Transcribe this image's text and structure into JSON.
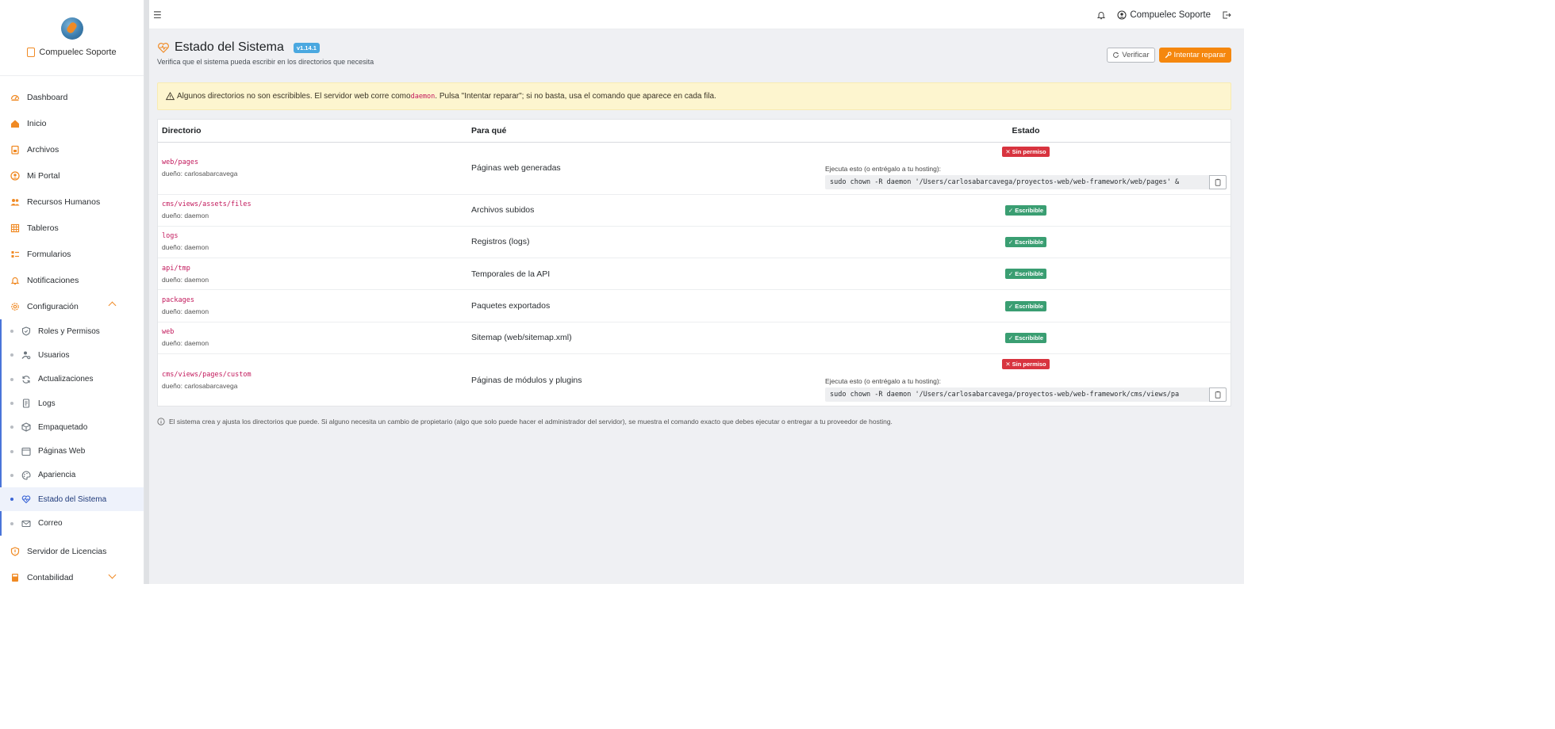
{
  "brand": {
    "name": "Compuelec Soporte"
  },
  "sidebar": {
    "items": [
      {
        "label": "Dashboard",
        "icon": "dashboard-icon"
      },
      {
        "label": "Inicio",
        "icon": "home-icon"
      },
      {
        "label": "Archivos",
        "icon": "archive-icon"
      },
      {
        "label": "Mi Portal",
        "icon": "user-circle-icon"
      },
      {
        "label": "Recursos Humanos",
        "icon": "users-icon"
      },
      {
        "label": "Tableros",
        "icon": "grid-icon"
      },
      {
        "label": "Formularios",
        "icon": "form-icon"
      },
      {
        "label": "Notificaciones",
        "icon": "bell-icon"
      },
      {
        "label": "Configuración",
        "icon": "gear-icon"
      }
    ],
    "sub_items": [
      {
        "label": "Roles y Permisos",
        "icon": "shield-icon"
      },
      {
        "label": "Usuarios",
        "icon": "user-gear-icon"
      },
      {
        "label": "Actualizaciones",
        "icon": "refresh-icon"
      },
      {
        "label": "Logs",
        "icon": "file-icon"
      },
      {
        "label": "Empaquetado",
        "icon": "box-icon"
      },
      {
        "label": "Páginas Web",
        "icon": "browser-icon"
      },
      {
        "label": "Apariencia",
        "icon": "palette-icon"
      },
      {
        "label": "Estado del Sistema",
        "icon": "heart-pulse-icon",
        "active": true
      },
      {
        "label": "Correo",
        "icon": "mail-icon"
      }
    ],
    "after_items": [
      {
        "label": "Servidor de Licencias",
        "icon": "shield-icon"
      },
      {
        "label": "Contabilidad",
        "icon": "calculator-icon"
      }
    ]
  },
  "topbar": {
    "user_name": "Compuelec Soporte"
  },
  "page": {
    "title": "Estado del Sistema",
    "version": "v1.14.1",
    "subtitle": "Verifica que el sistema pueda escribir en los directorios que necesita",
    "verify_label": "Verificar",
    "repair_label": "Intentar reparar"
  },
  "alert": {
    "text_before": "Algunos directorios no son escribibles. El servidor web corre como ",
    "code": "daemon",
    "text_after": ". Pulsa \"Intentar reparar\"; si no basta, usa el comando que aparece en cada fila."
  },
  "table": {
    "headers": [
      "Directorio",
      "Para qué",
      "Estado"
    ],
    "fix_label": "Ejecuta esto (o entrégalo a tu hosting):",
    "rows": [
      {
        "dir": "web/pages",
        "owner": "dueño: carlosabarcavega",
        "purpose": "Páginas web generadas",
        "status": "Sin permiso",
        "ok": false,
        "command": "sudo chown -R daemon '/Users/carlosabarcavega/proyectos-web/web-framework/web/pages' &"
      },
      {
        "dir": "cms/views/assets/files",
        "owner": "dueño: daemon",
        "purpose": "Archivos subidos",
        "status": "Escribible",
        "ok": true
      },
      {
        "dir": "logs",
        "owner": "dueño: daemon",
        "purpose": "Registros (logs)",
        "status": "Escribible",
        "ok": true
      },
      {
        "dir": "api/tmp",
        "owner": "dueño: daemon",
        "purpose": "Temporales de la API",
        "status": "Escribible",
        "ok": true
      },
      {
        "dir": "packages",
        "owner": "dueño: daemon",
        "purpose": "Paquetes exportados",
        "status": "Escribible",
        "ok": true
      },
      {
        "dir": "web",
        "owner": "dueño: daemon",
        "purpose": "Sitemap (web/sitemap.xml)",
        "status": "Escribible",
        "ok": true
      },
      {
        "dir": "cms/views/pages/custom",
        "owner": "dueño: carlosabarcavega",
        "purpose": "Páginas de módulos y plugins",
        "status": "Sin permiso",
        "ok": false,
        "command": "sudo chown -R daemon '/Users/carlosabarcavega/proyectos-web/web-framework/cms/views/pa"
      }
    ]
  },
  "footnote": "El sistema crea y ajusta los directorios que puede. Si alguno necesita un cambio de propietario (algo que solo puede hacer el administrador del servidor), se muestra el comando exacto que debes ejecutar o entregar a tu proveedor de hosting.",
  "colors": {
    "accent": "#f5870e",
    "ok": "#3a9e72",
    "bad": "#d8343f",
    "version": "#4aa8e0",
    "alert_bg": "#fdf5cf",
    "active_nav": "#3c66d6"
  }
}
